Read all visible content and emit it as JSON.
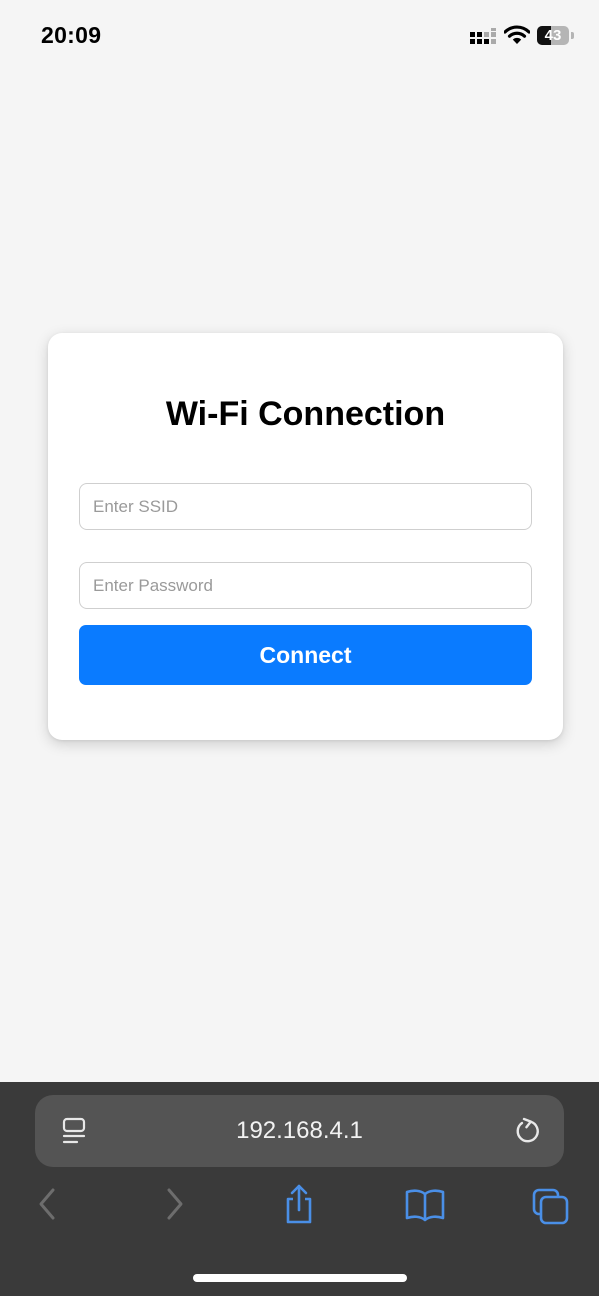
{
  "status_bar": {
    "time": "20:09",
    "battery_level": "43",
    "battery_fraction": 0.43,
    "icons": [
      "signal-icon",
      "wifi-icon",
      "battery-icon"
    ]
  },
  "form": {
    "title": "Wi-Fi Connection",
    "ssid_placeholder": "Enter SSID",
    "ssid_value": "",
    "password_placeholder": "Enter Password",
    "password_value": "",
    "connect_label": "Connect"
  },
  "browser": {
    "url": "192.168.4.1",
    "icons": [
      "reader-icon",
      "reload-icon",
      "back-icon",
      "forward-icon",
      "share-icon",
      "bookmarks-icon",
      "tabs-icon"
    ]
  },
  "colors": {
    "accent": "#0a7bff",
    "page_background": "#f5f5f5",
    "card_background": "#ffffff",
    "toolbar_background": "#3a3a3a",
    "toolbar_icon_active": "#4a8fe7",
    "toolbar_icon_disabled": "#6d6d6d"
  }
}
